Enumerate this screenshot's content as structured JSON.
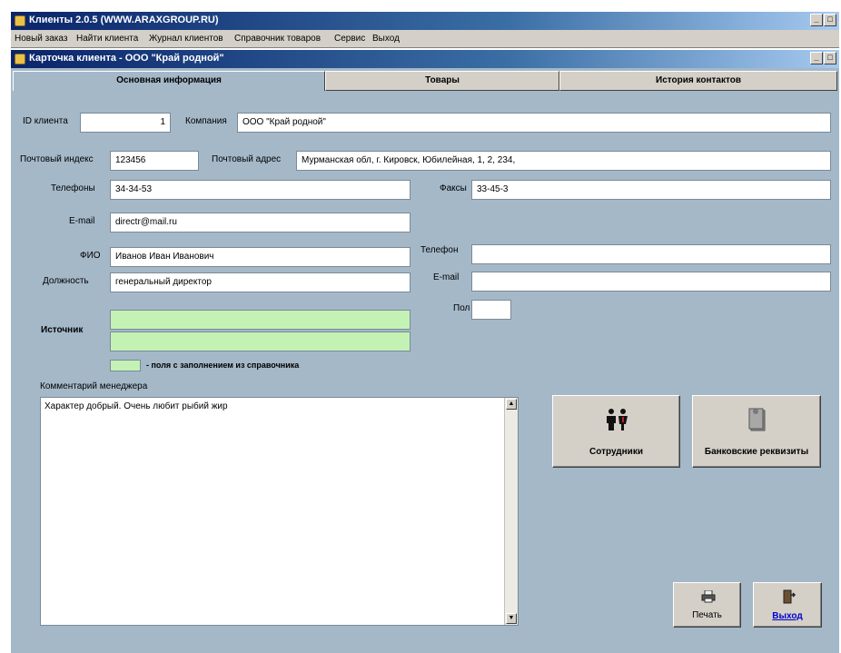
{
  "app": {
    "title": "Клиенты 2.0.5 (WWW.ARAXGROUP.RU)"
  },
  "menu": [
    "Новый заказ",
    "Найти клиента",
    "Журнал клиентов",
    "Справочник товаров",
    "Сервис",
    "Выход"
  ],
  "window": {
    "title": "Карточка клиента  -  ООО \"Край родной\""
  },
  "tabs": [
    "Основная информация",
    "Товары",
    "История контактов"
  ],
  "form": {
    "client_id": {
      "label": "ID клиента",
      "value": "1"
    },
    "company": {
      "label": "Компания",
      "value": "ООО \"Край родной\""
    },
    "postal_index": {
      "label": "Почтовый индекс",
      "value": "123456"
    },
    "postal_address": {
      "label": "Почтовый адрес",
      "value": "Мурманская обл, г. Кировск, Юбилейная, 1, 2, 234,"
    },
    "phones": {
      "label": "Телефоны",
      "value": "34-34-53"
    },
    "faxes": {
      "label": "Факсы",
      "value": "33-45-3"
    },
    "email": {
      "label": "E-mail",
      "value": "directr@mail.ru"
    },
    "fio": {
      "label": "ФИО",
      "value": "Иванов Иван Иванович"
    },
    "position": {
      "label": "Должность",
      "value": "генеральный директор"
    },
    "contact_phone": {
      "label": "Телефон",
      "value": ""
    },
    "contact_email": {
      "label": "E-mail",
      "value": ""
    },
    "gender": {
      "label": "Пол",
      "value": ""
    },
    "source": {
      "label": "Источник",
      "value1": "",
      "value2": ""
    },
    "legend": "- поля с заполнением из справочника",
    "comment": {
      "label": "Комментарий менеджера",
      "value": "Характер добрый. Очень любит рыбий жир"
    }
  },
  "buttons": {
    "employees": "Сотрудники",
    "bank_details": "Банковские реквизиты",
    "print": "Печать",
    "exit": "Выход"
  },
  "colors": {
    "client_bg": "#a4b8c8",
    "lookup_field": "#c4f2b4",
    "title_bar": "#0a246a"
  }
}
